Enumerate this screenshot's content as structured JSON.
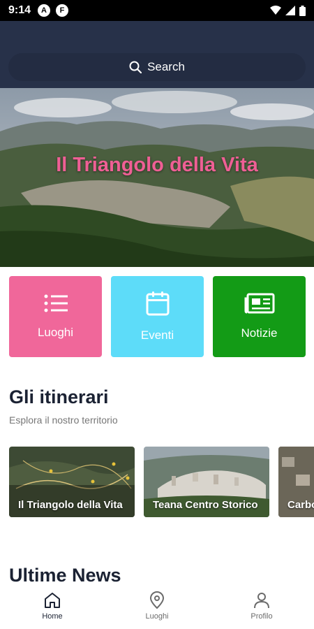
{
  "status_bar": {
    "time": "9:14",
    "app_icons": [
      "A",
      "F"
    ]
  },
  "search": {
    "label": "Search"
  },
  "hero": {
    "title": "Il Triangolo della Vita"
  },
  "tiles": [
    {
      "label": "Luoghi",
      "color": "#f0679a",
      "icon": "list-icon"
    },
    {
      "label": "Eventi",
      "color": "#5ddcf9",
      "icon": "calendar-icon"
    },
    {
      "label": "Notizie",
      "color": "#139b16",
      "icon": "newspaper-icon"
    }
  ],
  "itinerari": {
    "title": "Gli itinerari",
    "subtitle": "Esplora il nostro territorio",
    "cards": [
      {
        "label": "Il Triangolo della Vita"
      },
      {
        "label": "Teana Centro Storico"
      },
      {
        "label": "Carbone Storico"
      }
    ]
  },
  "news": {
    "title": "Ultime News"
  },
  "bottom_nav": [
    {
      "label": "Home",
      "icon": "home-icon",
      "active": true
    },
    {
      "label": "Luoghi",
      "icon": "location-pin-icon",
      "active": false
    },
    {
      "label": "Profilo",
      "icon": "user-icon",
      "active": false
    }
  ]
}
